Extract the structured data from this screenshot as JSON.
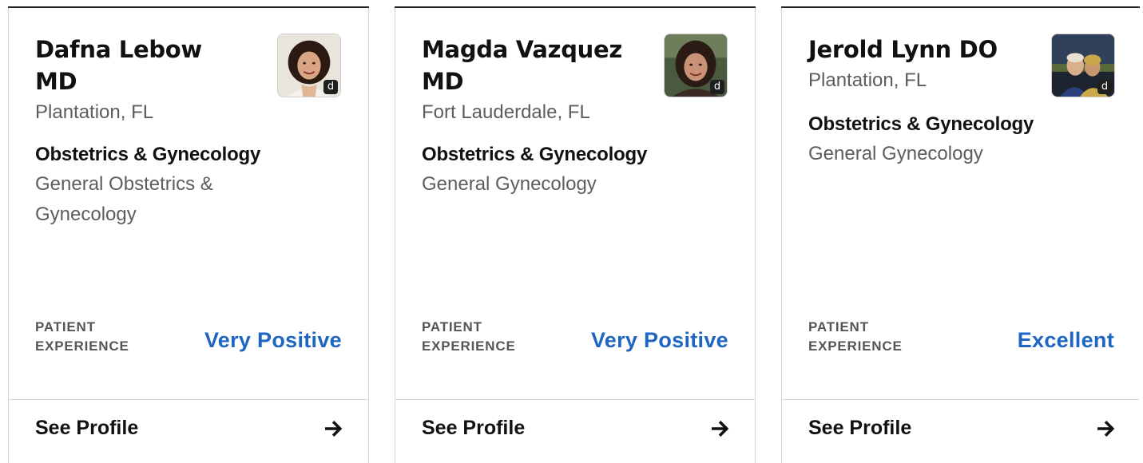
{
  "cards": [
    {
      "name": "Dafna Lebow MD",
      "location": "Plantation, FL",
      "specialty": "Obstetrics & Gynecology",
      "subspecialty": "General Obstetrics & Gynecology",
      "patient_experience_label": "PATIENT EXPERIENCE",
      "patient_experience_value": "Very Positive",
      "badge": "d",
      "link_label": "See Profile",
      "link_icon": "arrow-right-icon"
    },
    {
      "name": "Magda Vazquez MD",
      "location": "Fort Lauderdale, FL",
      "specialty": "Obstetrics & Gynecology",
      "subspecialty": "General Gynecology",
      "patient_experience_label": "PATIENT EXPERIENCE",
      "patient_experience_value": "Very Positive",
      "badge": "d",
      "link_label": "See Profile",
      "link_icon": "arrow-right-icon"
    },
    {
      "name": "Jerold Lynn DO",
      "location": "Plantation, FL",
      "specialty": "Obstetrics & Gynecology",
      "subspecialty": "General Gynecology",
      "patient_experience_label": "PATIENT EXPERIENCE",
      "patient_experience_value": "Excellent",
      "badge": "d",
      "link_label": "See Profile",
      "link_icon": "arrow-right-icon"
    }
  ],
  "colors": {
    "rating": "#1f66c3",
    "text_primary": "#111111",
    "text_secondary": "#5d5d5d",
    "border": "#d6d6d6"
  }
}
